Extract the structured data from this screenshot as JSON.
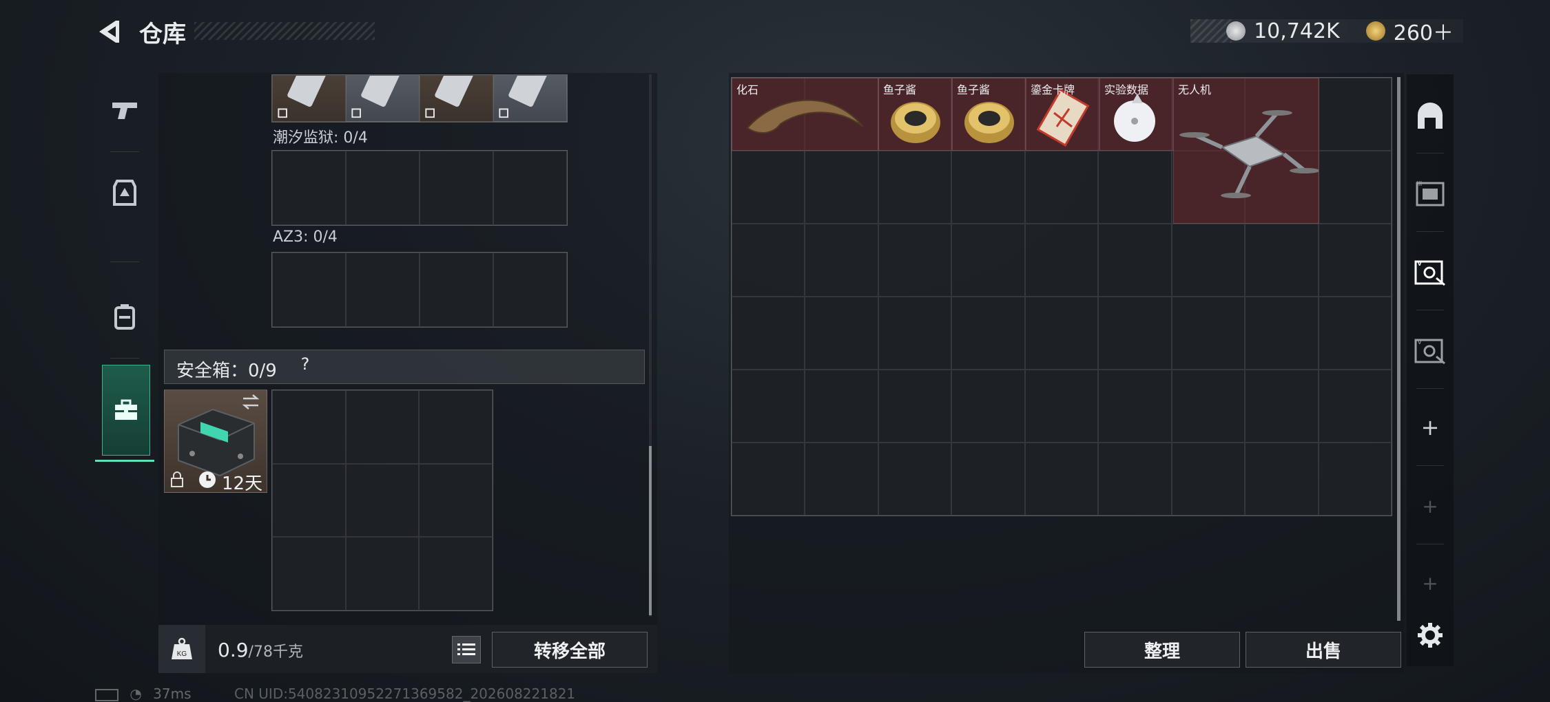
{
  "header": {
    "title": "仓库",
    "currency": [
      {
        "icon": "silver-coin-icon",
        "value": "10,742K"
      },
      {
        "icon": "gold-coin-icon",
        "value": "260＋"
      }
    ]
  },
  "left_panel": {
    "containers": [
      {
        "label": "潮汐监狱: 0/4"
      },
      {
        "label": "AZ3: 0/4"
      }
    ],
    "safebox": {
      "label": "安全箱：0/9",
      "help": "?",
      "days": "12天"
    },
    "weight": {
      "value": "0.9",
      "unit": "/78千克"
    },
    "transfer_all": "转移全部"
  },
  "stash": {
    "items": [
      {
        "label": "化石"
      },
      {
        "label": "鱼子酱"
      },
      {
        "label": "鱼子酱"
      },
      {
        "label": "鎏金卡牌"
      },
      {
        "label": "实验数据"
      },
      {
        "label": "无人机"
      }
    ],
    "sort_button": "整理",
    "sell_button": "出售"
  },
  "status": {
    "ping": "37ms",
    "uid": "CN UID:5408231095227136958​2_202608221821"
  },
  "colors": {
    "accent": "#5fe0b5",
    "item_bg": "#6e282c"
  }
}
